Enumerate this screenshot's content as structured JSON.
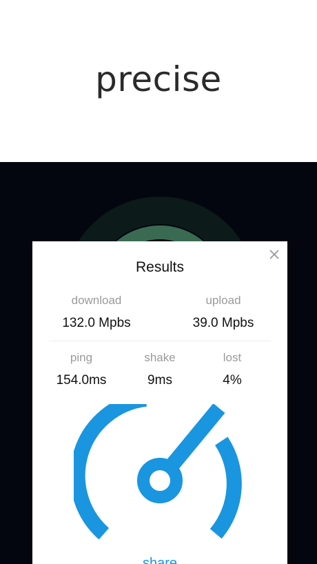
{
  "headline": "precise",
  "results": {
    "title": "Results",
    "download": {
      "label": "download",
      "value": "132.0 Mpbs"
    },
    "upload": {
      "label": "upload",
      "value": "39.0 Mpbs"
    },
    "ping": {
      "label": "ping",
      "value": "154.0ms"
    },
    "shake": {
      "label": "shake",
      "value": "9ms"
    },
    "lost": {
      "label": "lost",
      "value": "4%"
    },
    "share_label": "share"
  },
  "colors": {
    "accent": "#1a95e0",
    "background_dark": "#04060f",
    "glow_ring": "#3a6b52"
  },
  "icons": [
    "close-icon",
    "speedometer-icon"
  ]
}
